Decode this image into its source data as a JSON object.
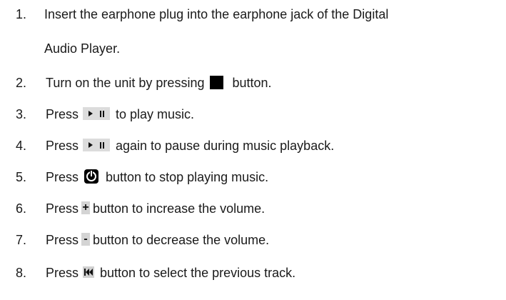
{
  "items": [
    {
      "num": "1.",
      "line1": "Insert the earphone plug into the earphone jack of the Digital",
      "line2": "Audio Player."
    },
    {
      "num": "2.",
      "before": "Turn on the unit by pressing",
      "after": "button.",
      "icon": "black-square-button-icon"
    },
    {
      "num": "3.",
      "before": "Press",
      "after": "to play music.",
      "icon": "play-pause-icon"
    },
    {
      "num": "4.",
      "before": "Press",
      "after": "again to pause during music playback.",
      "icon": "play-pause-icon"
    },
    {
      "num": "5.",
      "before": "Press",
      "after": "button to stop playing music.",
      "icon": "power-icon"
    },
    {
      "num": "6.",
      "before": "Press",
      "btn": "+",
      "after": "button to increase the volume.",
      "icon": "plus-icon"
    },
    {
      "num": "7.",
      "before": "Press",
      "btn": "-",
      "after": "button to decrease the volume.",
      "icon": "minus-icon"
    },
    {
      "num": "8.",
      "before": "Press",
      "after": "button to select the previous track.",
      "icon": "previous-track-icon"
    }
  ]
}
